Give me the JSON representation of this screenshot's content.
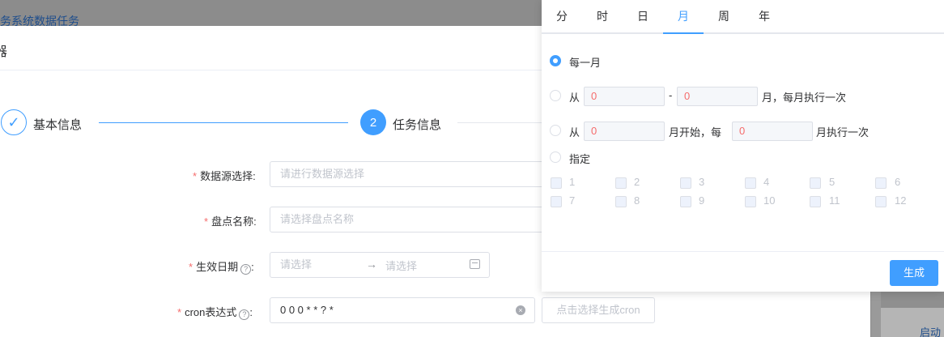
{
  "backdrop": {
    "title": "务系统数据任务",
    "strip_text": "启动"
  },
  "dialog": {
    "title": "器"
  },
  "steps": [
    {
      "label": "基本信息",
      "status": "done",
      "icon": "check-icon"
    },
    {
      "label": "任务信息",
      "status": "active",
      "number": "2"
    }
  ],
  "form": {
    "datasource": {
      "label": "数据源选择:",
      "placeholder": "请进行数据源选择"
    },
    "inventory_name": {
      "label": "盘点名称:",
      "placeholder": "请选择盘点名称"
    },
    "effective_date": {
      "label": "生效日期",
      "help": "?",
      "colon": ":",
      "start_placeholder": "请选择",
      "separator": "→",
      "end_placeholder": "请选择"
    },
    "cron": {
      "label": "cron表达式",
      "help": "?",
      "colon": ":",
      "value": "0 0 0 * * ? *",
      "generate_button": "点击选择生成cron"
    }
  },
  "cron_panel": {
    "tabs": [
      "分",
      "时",
      "日",
      "月",
      "周",
      "年"
    ],
    "active_tab": "月",
    "options": {
      "every": "每一月",
      "range": {
        "from": "从",
        "start": "0",
        "dash": "-",
        "end": "0",
        "suffix": "月，每月执行一次"
      },
      "interval": {
        "from": "从",
        "start": "0",
        "mid": "月开始，每",
        "step": "0",
        "suffix": "月执行一次"
      },
      "specify": "指定"
    },
    "months": [
      "1",
      "2",
      "3",
      "4",
      "5",
      "6",
      "7",
      "8",
      "9",
      "10",
      "11",
      "12"
    ],
    "generate": "生成"
  },
  "colors": {
    "primary": "#409eff",
    "danger": "#f56c6c",
    "border": "#dcdfe6"
  }
}
